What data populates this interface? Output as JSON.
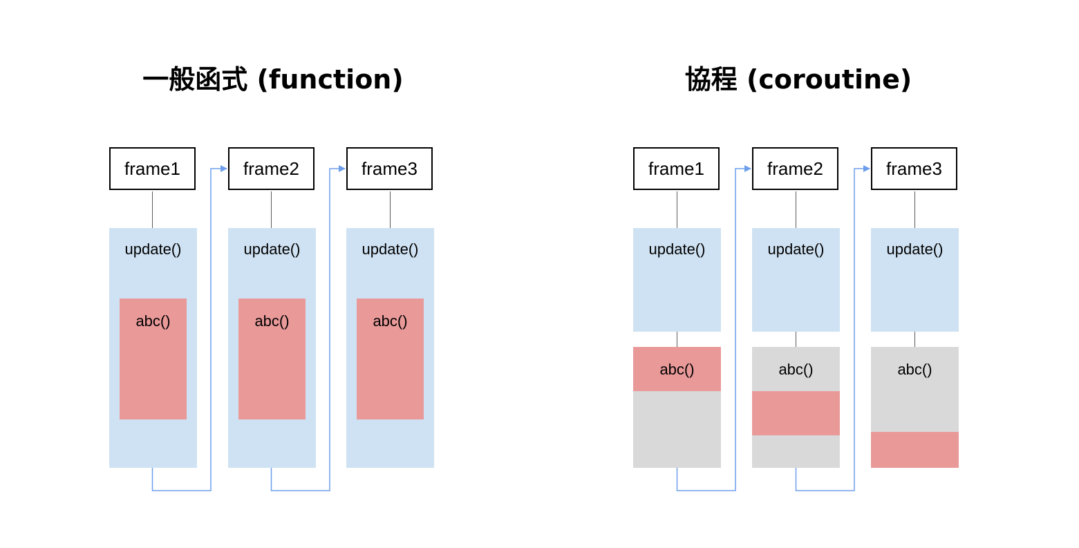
{
  "left": {
    "title": "一般函式 (function)",
    "frames": [
      "frame1",
      "frame2",
      "frame3"
    ],
    "update_label": "update()",
    "abc_label": "abc()"
  },
  "right": {
    "title": "協程 (coroutine)",
    "frames": [
      "frame1",
      "frame2",
      "frame3"
    ],
    "update_label": "update()",
    "abc_label": "abc()"
  },
  "colors": {
    "update_block": "#cfe2f3",
    "abc_block": "#ea9999",
    "pending_block": "#d9d9d9",
    "arrow": "#6d9eeb"
  }
}
